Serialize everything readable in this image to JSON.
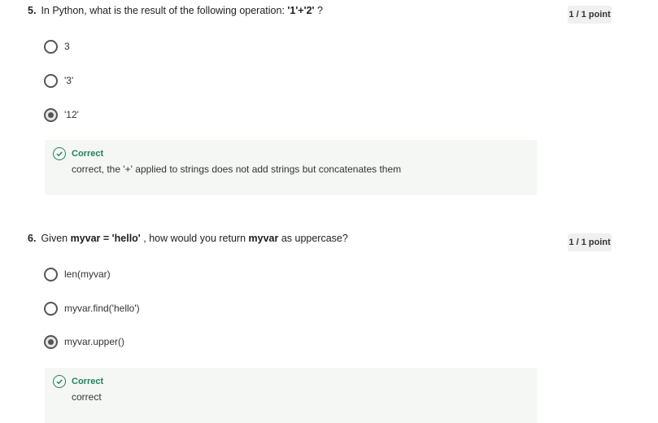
{
  "questions": [
    {
      "number": "5.",
      "text_pre": "In Python, what is the result of the following operation: ",
      "text_bold": "'1'+'2'",
      "text_post": " ?",
      "points": "1 / 1 point",
      "options": [
        {
          "label": "3",
          "selected": false
        },
        {
          "label": "'3'",
          "selected": false
        },
        {
          "label": "'12'",
          "selected": true
        }
      ],
      "feedback": {
        "title": "Correct",
        "text": "correct, the '+' applied to strings does not add strings but concatenates them"
      }
    },
    {
      "number": "6.",
      "text_pre": "Given ",
      "text_bold": "myvar = 'hello'",
      "text_mid": " , how would you return ",
      "text_bold2": "myvar",
      "text_post": " as uppercase?",
      "points": "1 / 1 point",
      "options": [
        {
          "label": "len(myvar)",
          "selected": false
        },
        {
          "label": "myvar.find('hello')",
          "selected": false
        },
        {
          "label": "myvar.upper()",
          "selected": true
        }
      ],
      "feedback": {
        "title": "Correct",
        "text": "correct"
      }
    }
  ],
  "colors": {
    "correct": "#1f8354",
    "points_bg": "#f0f0f0",
    "feedback_bg": "#f5f7f5"
  },
  "icons": {
    "feedback": "check-circle-icon"
  }
}
